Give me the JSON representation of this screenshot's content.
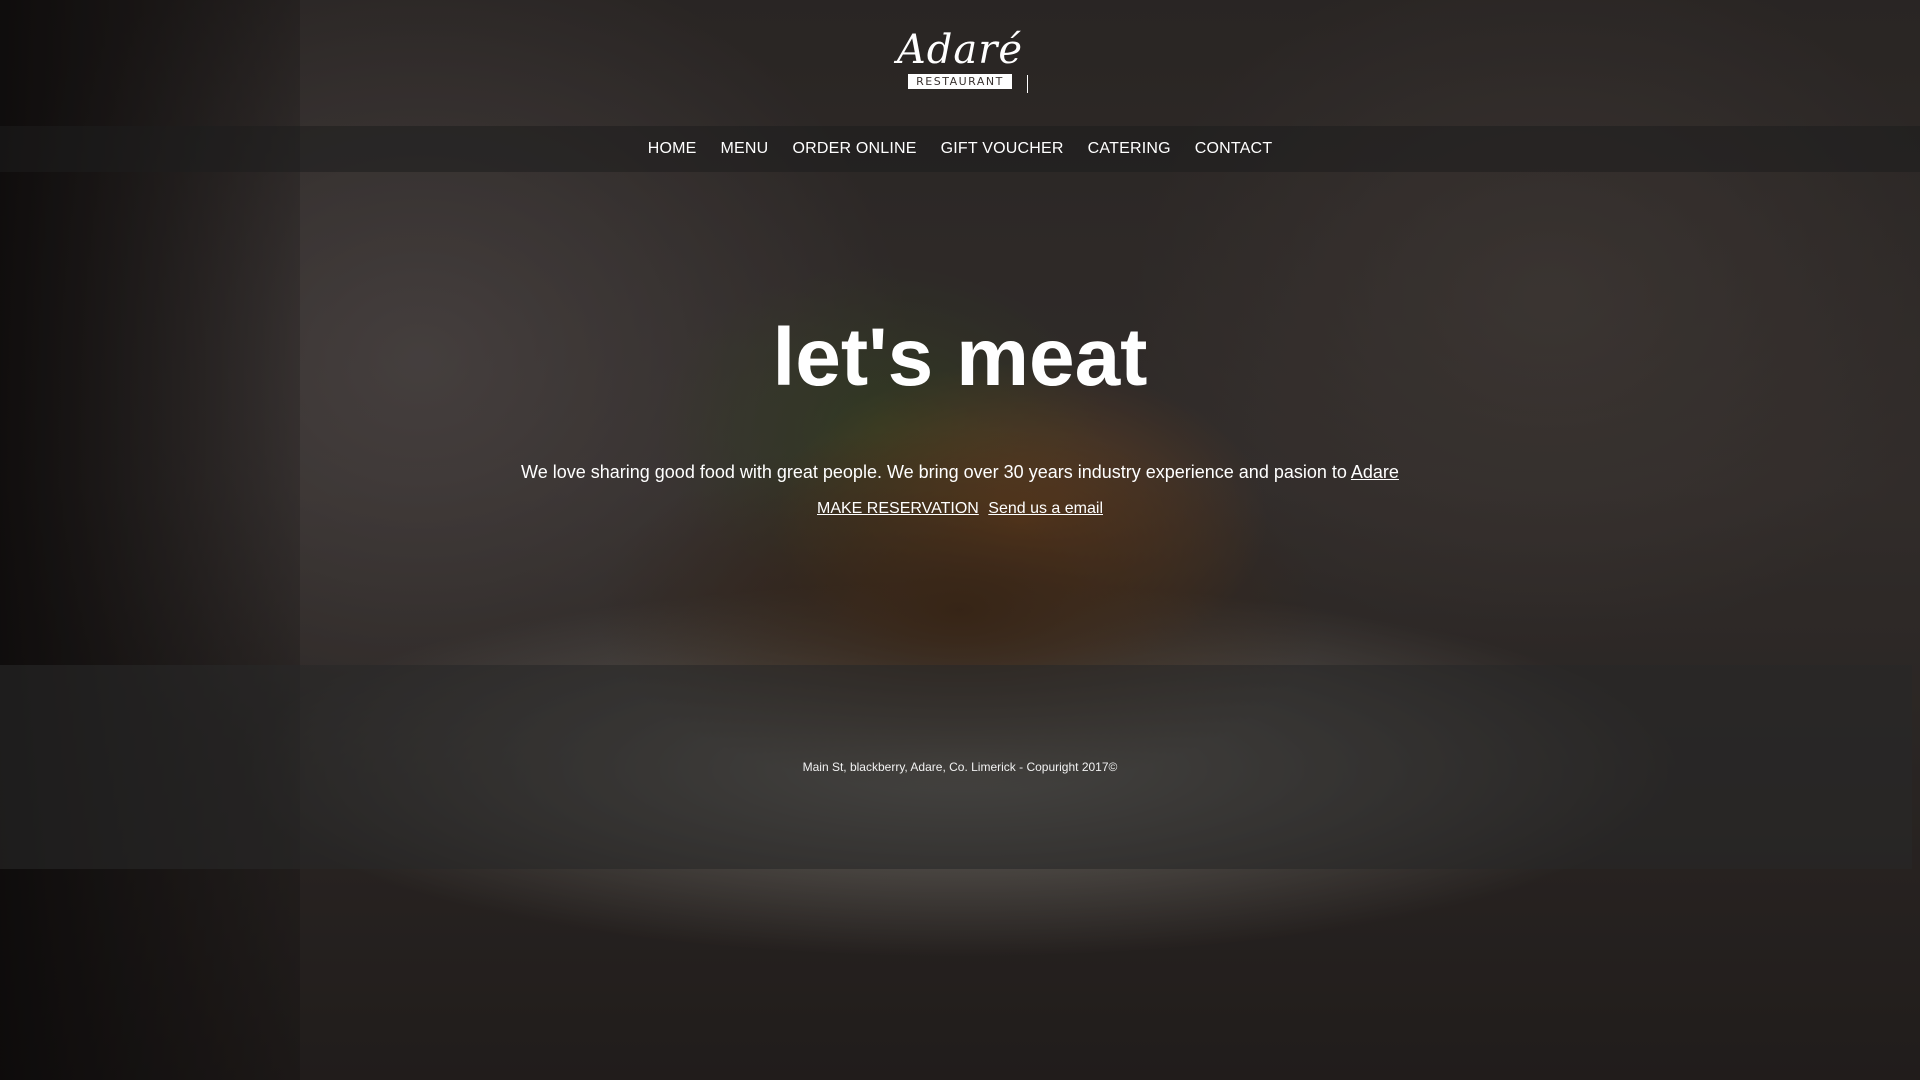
{
  "brand": {
    "name": "Adaré",
    "tagline": "RESTAURANT"
  },
  "nav": {
    "items": [
      {
        "label": "HOME"
      },
      {
        "label": "MENU"
      },
      {
        "label": "ORDER ONLINE"
      },
      {
        "label": "GIFT VOUCHER"
      },
      {
        "label": "CATERING"
      },
      {
        "label": "CONTACT"
      }
    ]
  },
  "hero": {
    "title": "let's meat",
    "text": "We love sharing good food with great people. We bring over 30 years industry experience and pasion to",
    "text_link": "Adare",
    "reservation_link": "MAKE RESERVATION",
    "email_link": "Send us a email"
  },
  "footer": {
    "address": "Main St, blackberry, Adare, Co. Limerick - Copuright 2017©"
  },
  "colors": {
    "text": "#ffffff",
    "navbar_bg": "rgba(30,30,30,0.55)",
    "footer_bg": "rgba(40,40,40,0.6)"
  }
}
